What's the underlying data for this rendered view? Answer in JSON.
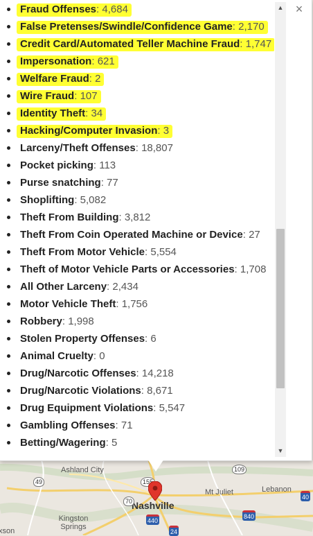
{
  "offense_list": [
    {
      "name": "Fraud Offenses",
      "count": "4,684",
      "highlighted": true
    },
    {
      "name": "False Pretenses/Swindle/Confidence Game",
      "count": "2,170",
      "highlighted": true
    },
    {
      "name": "Credit Card/Automated Teller Machine Fraud",
      "count": "1,747",
      "highlighted": true
    },
    {
      "name": "Impersonation",
      "count": "621",
      "highlighted": true
    },
    {
      "name": "Welfare Fraud",
      "count": "2",
      "highlighted": true
    },
    {
      "name": "Wire Fraud",
      "count": "107",
      "highlighted": true
    },
    {
      "name": "Identity Theft",
      "count": "34",
      "highlighted": true
    },
    {
      "name": "Hacking/Computer Invasion",
      "count": "3",
      "highlighted": true
    },
    {
      "name": "Larceny/Theft Offenses",
      "count": "18,807",
      "highlighted": false
    },
    {
      "name": "Pocket picking",
      "count": "113",
      "highlighted": false
    },
    {
      "name": "Purse snatching",
      "count": "77",
      "highlighted": false
    },
    {
      "name": "Shoplifting",
      "count": "5,082",
      "highlighted": false
    },
    {
      "name": "Theft From Building",
      "count": "3,812",
      "highlighted": false
    },
    {
      "name": "Theft From Coin Operated Machine or Device",
      "count": "27",
      "highlighted": false
    },
    {
      "name": "Theft From Motor Vehicle",
      "count": "5,554",
      "highlighted": false
    },
    {
      "name": "Theft of Motor Vehicle Parts or Accessories",
      "count": "1,708",
      "highlighted": false
    },
    {
      "name": "All Other Larceny",
      "count": "2,434",
      "highlighted": false
    },
    {
      "name": "Motor Vehicle Theft",
      "count": "1,756",
      "highlighted": false
    },
    {
      "name": "Robbery",
      "count": "1,998",
      "highlighted": false
    },
    {
      "name": "Stolen Property Offenses",
      "count": "6",
      "highlighted": false
    },
    {
      "name": "Animal Cruelty",
      "count": "0",
      "highlighted": false
    },
    {
      "name": "Drug/Narcotic Offenses",
      "count": "14,218",
      "highlighted": false
    },
    {
      "name": "Drug/Narcotic Violations",
      "count": "8,671",
      "highlighted": false
    },
    {
      "name": "Drug Equipment Violations",
      "count": "5,547",
      "highlighted": false
    },
    {
      "name": "Gambling Offenses",
      "count": "71",
      "highlighted": false
    },
    {
      "name": "Betting/Wagering",
      "count": "5",
      "highlighted": false
    }
  ],
  "separator": ": ",
  "highlight_color": "#ffff33",
  "close_icon": "close-icon",
  "close_glyph": "×",
  "scroll_up_glyph": "▲",
  "scroll_down_glyph": "▼",
  "map": {
    "cities": [
      "Ashland City",
      "Nashville",
      "Mt Juliet",
      "Lebanon",
      "Kingston Springs"
    ],
    "shields": {
      "us_49": "49",
      "us_155": "155",
      "us_109": "109",
      "us_70": "70",
      "i_440": "440",
      "i_840": "840",
      "i_40": "40",
      "us_24": "24"
    },
    "edge_label": "xson"
  }
}
